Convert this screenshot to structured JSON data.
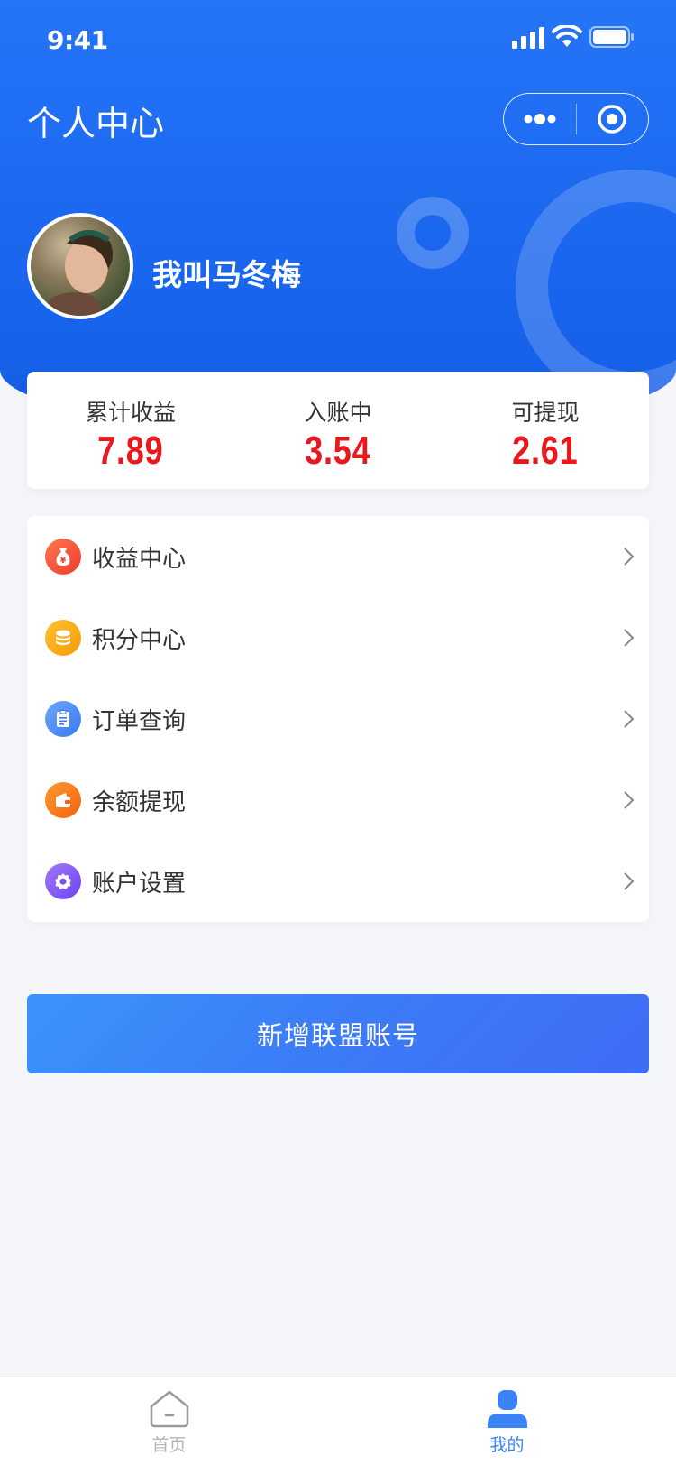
{
  "status_bar": {
    "time": "9:41"
  },
  "nav": {
    "title": "个人中心"
  },
  "user": {
    "name": "我叫马冬梅"
  },
  "stats": [
    {
      "label": "累计收益",
      "value": "7.89"
    },
    {
      "label": "入账中",
      "value": "3.54"
    },
    {
      "label": "可提现",
      "value": "2.61"
    }
  ],
  "menu": [
    {
      "label": "收益中心",
      "icon": "money-bag-icon",
      "color": "#f45a3a"
    },
    {
      "label": "积分中心",
      "icon": "coins-icon",
      "color": "#f9a90b"
    },
    {
      "label": "订单查询",
      "icon": "clipboard-icon",
      "color": "#4f8ef5"
    },
    {
      "label": "余额提现",
      "icon": "wallet-icon",
      "color": "#f77a1e"
    },
    {
      "label": "账户设置",
      "icon": "settings-icon",
      "color": "#8e5cf4"
    }
  ],
  "actions": {
    "add_account": "新增联盟账号"
  },
  "tabs": [
    {
      "label": "首页",
      "active": false
    },
    {
      "label": "我的",
      "active": true
    }
  ],
  "colors": {
    "primary": "#1a66ee",
    "accent_value": "#e8181d",
    "tab_active": "#3b82f6"
  }
}
